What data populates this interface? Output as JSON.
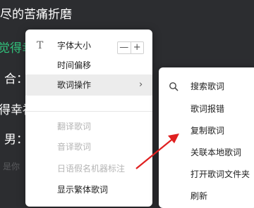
{
  "background": {
    "line1": "尽的苦痛折磨",
    "line2": "觉得幸",
    "line3": "合：",
    "line4": "得幸福",
    "line5": "男：",
    "line6": "是你"
  },
  "main_menu": {
    "font_size": "字体大小",
    "time_offset": "时间偏移",
    "time_offset_control": "‹‹••››",
    "lyrics_actions": "歌词操作",
    "translate": "翻译歌词",
    "transliterate": "音译歌词",
    "kana": "日语假名机器标注",
    "traditional": "显示繁体歌词"
  },
  "stepper": {
    "minus": "—",
    "plus": "+"
  },
  "sub_menu": {
    "search": "搜索歌词",
    "report": "歌词报错",
    "copy": "复制歌词",
    "link_local": "关联本地歌词",
    "open_folder": "打开歌词文件夹",
    "refresh": "刷新"
  },
  "colors": {
    "background": "#2c2d30",
    "accent_green": "#31c27c",
    "arrow_red": "#e02020"
  }
}
